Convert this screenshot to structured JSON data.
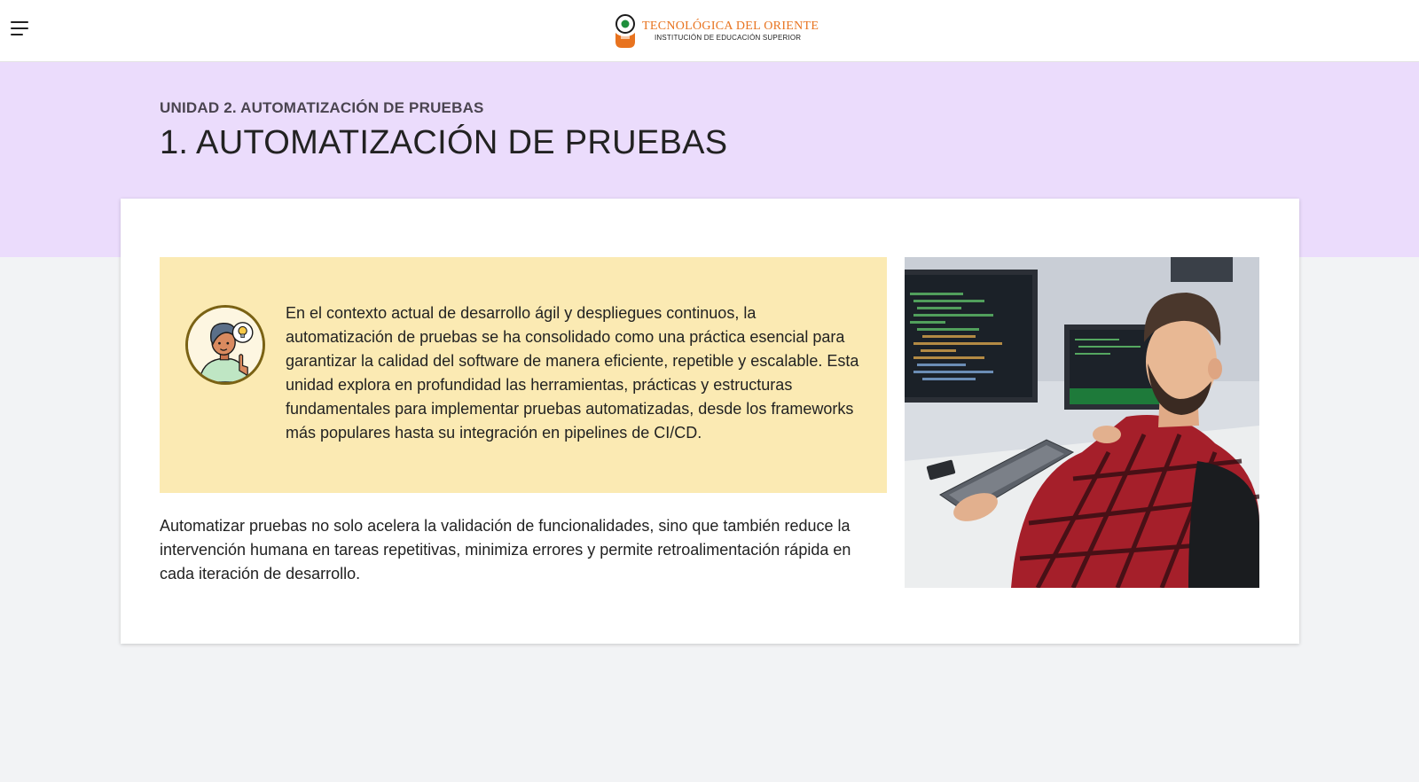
{
  "header": {
    "menu_icon": "hamburger-menu-icon",
    "logo": {
      "name": "TECNOLÓGICA DEL ORIENTE",
      "subtitle": "INSTITUCIÓN DE EDUCACIÓN SUPERIOR",
      "brand_color": "#e8731f",
      "mark_colors": [
        "#1e8f3c",
        "#e8731f"
      ]
    }
  },
  "hero": {
    "unit_label": "UNIDAD 2. AUTOMATIZACIÓN DE PRUEBAS",
    "title": "1. AUTOMATIZACIÓN DE PRUEBAS",
    "background": "#ebdcfc"
  },
  "content": {
    "callout": {
      "icon": "idea-person-avatar-icon",
      "background": "#fbeab3",
      "text": "En el contexto actual de desarrollo ágil y despliegues continuos, la automatización de pruebas se ha consolidado como una práctica esencial para garantizar la calidad del software de manera eficiente, repetible y escalable. Esta unidad explora en profundidad las herramientas, prácticas y estructuras fundamentales para implementar pruebas automatizadas, desde los frameworks más populares hasta su integración en pipelines de CI/CD."
    },
    "paragraph": "Automatizar pruebas no solo acelera la validación de funcionalidades, sino que también reduce la intervención humana en tareas repetitivas, minimiza errores y permite retroalimentación rápida en cada iteración de desarrollo.",
    "image": "developer-at-computer-photo"
  }
}
